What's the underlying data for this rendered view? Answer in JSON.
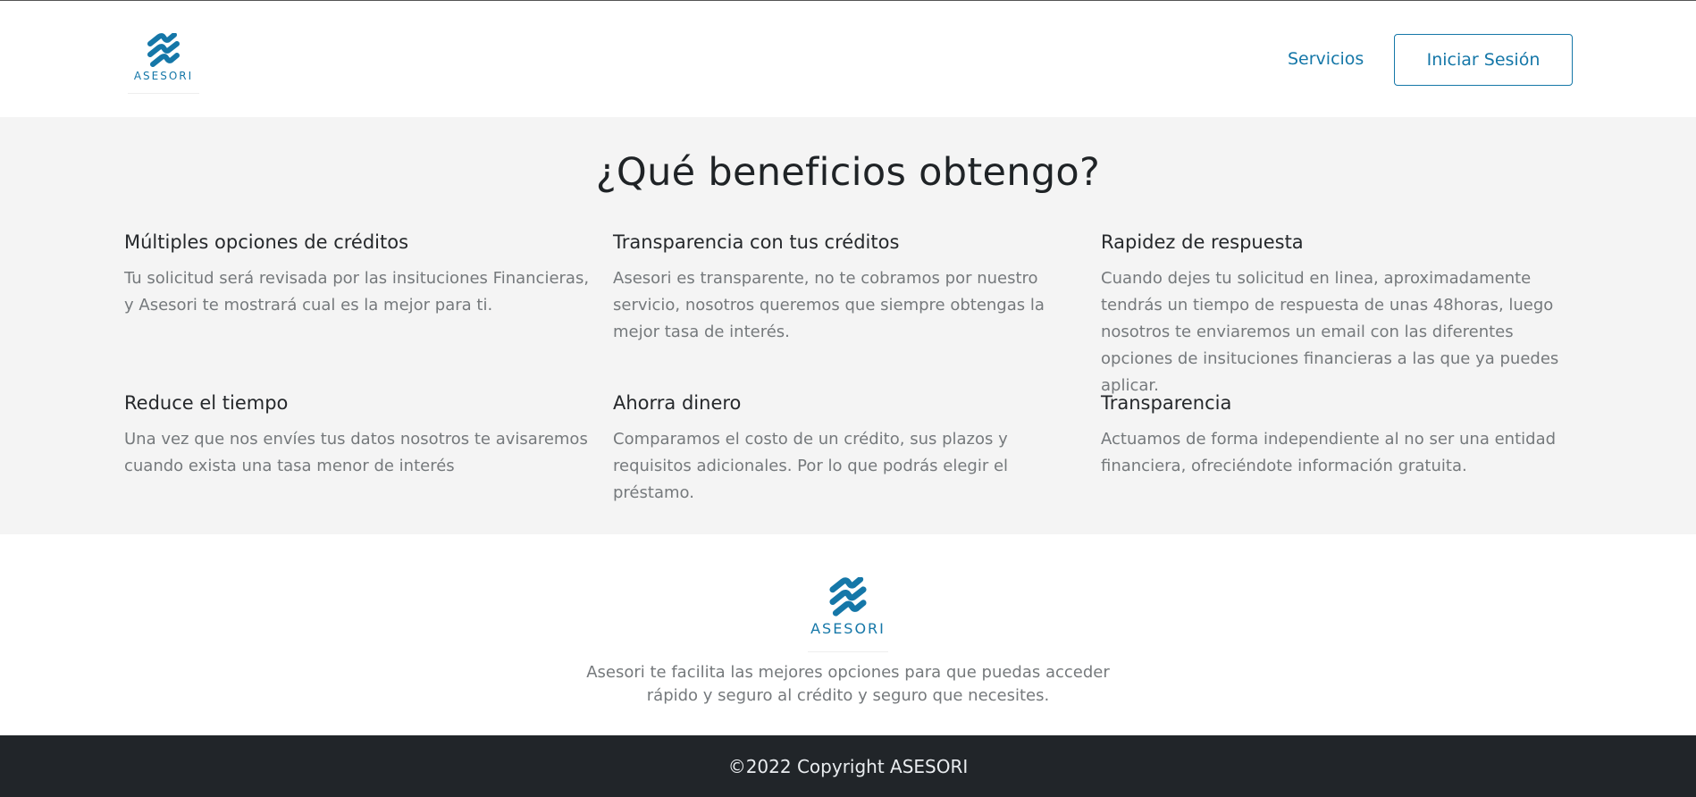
{
  "brand": {
    "name": "ASESORI",
    "color": "#1577a8"
  },
  "header": {
    "nav_services": "Servicios",
    "login_label": "Iniciar Sesión"
  },
  "benefits": {
    "title": "¿Qué beneficios obtengo?",
    "items": [
      {
        "title": "Múltiples opciones de créditos",
        "text": "Tu solicitud será revisada por las insituciones Financieras, y Asesori te mostrará cual es la mejor para ti."
      },
      {
        "title": "Transparencia con tus créditos",
        "text": "Asesori es transparente, no te cobramos por nuestro servicio, nosotros queremos que siempre obtengas la mejor tasa de interés."
      },
      {
        "title": "Rapidez de respuesta",
        "text": "Cuando dejes tu solicitud en linea, aproximadamente tendrás un tiempo de respuesta de unas 48horas, luego nosotros te enviaremos un email con las diferentes opciones de insituciones financieras a las que ya puedes aplicar."
      },
      {
        "title": "Reduce el tiempo",
        "text": "Una vez que nos envíes tus datos nosotros te avisaremos cuando exista una tasa menor de interés"
      },
      {
        "title": "Ahorra dinero",
        "text": "Comparamos el costo de un crédito, sus plazos y requisitos adicionales. Por lo que podrás elegir el préstamo."
      },
      {
        "title": "Transparencia",
        "text": "Actuamos de forma independiente al no ser una entidad financiera, ofreciéndote información gratuita."
      }
    ]
  },
  "footer": {
    "description": "Asesori te facilita las mejores opciones para que puedas acceder rápido y seguro al crédito y seguro que necesites.",
    "copyright": "©2022 Copyright ASESORI"
  },
  "colors": {
    "benefits_bg": "#f4f4f4",
    "copyright_bg": "#212529"
  }
}
